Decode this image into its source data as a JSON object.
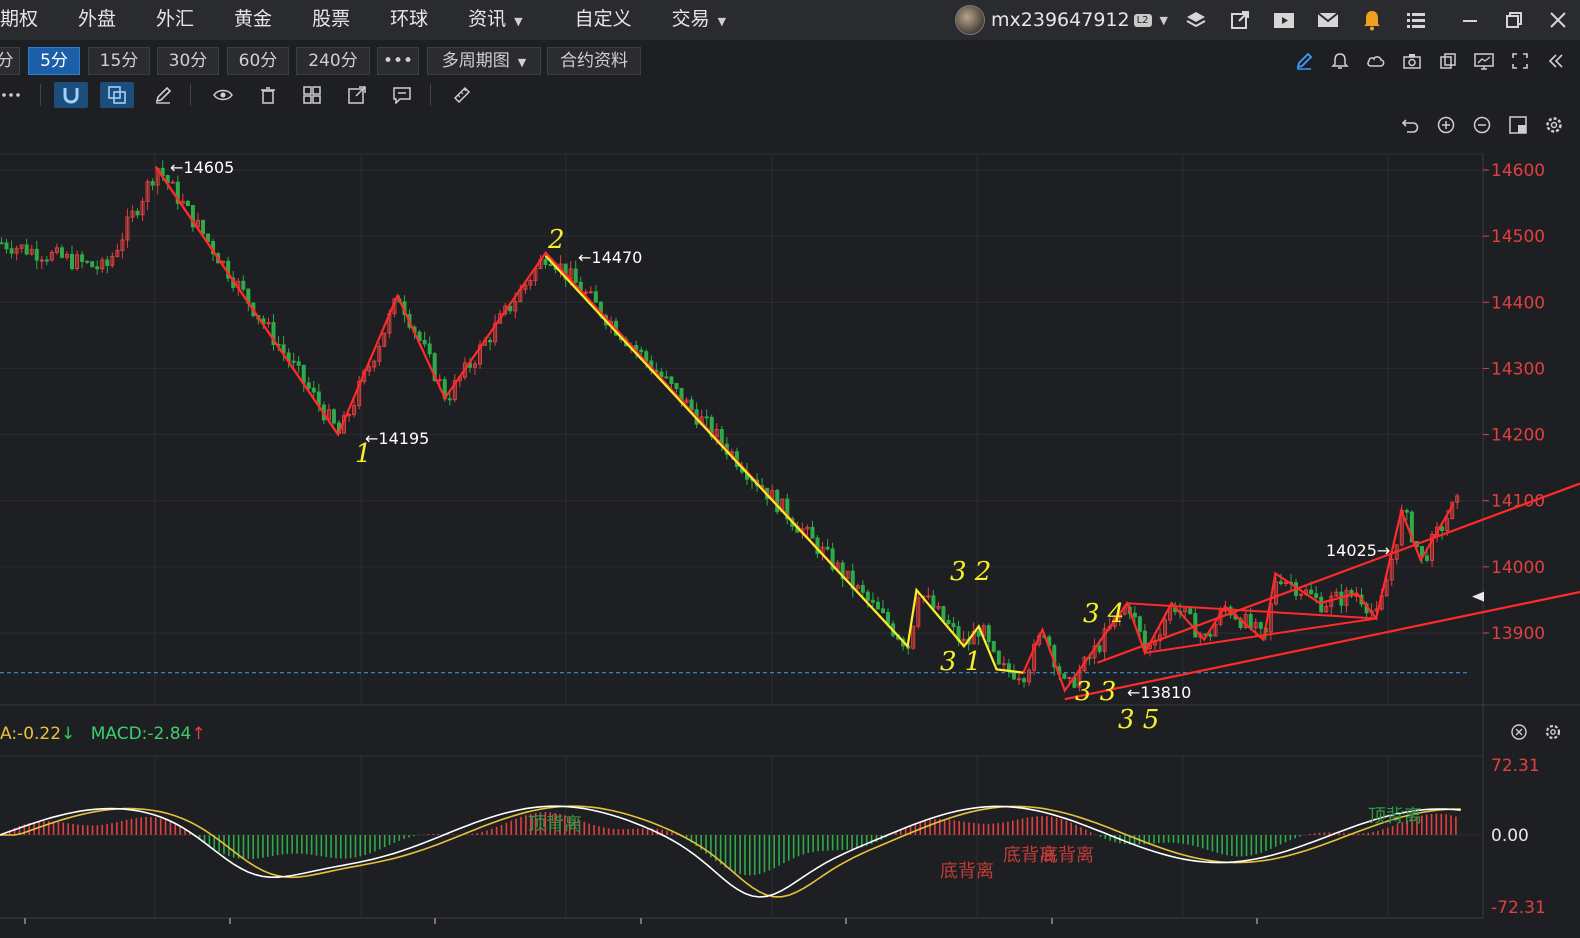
{
  "menu": {
    "items": [
      {
        "label": "期权",
        "caret": false
      },
      {
        "label": "外盘",
        "caret": false
      },
      {
        "label": "外汇",
        "caret": false
      },
      {
        "label": "黄金",
        "caret": false
      },
      {
        "label": "股票",
        "caret": false
      },
      {
        "label": "环球",
        "caret": false
      },
      {
        "label": "资讯",
        "caret": true
      },
      {
        "label": "自定义",
        "caret": false
      },
      {
        "label": "交易",
        "caret": true
      }
    ],
    "username": "mx239647912",
    "badge": "L2",
    "icons": [
      "layers-icon",
      "export-icon",
      "video-icon",
      "mail-icon",
      "bell-icon",
      "list-icon",
      "minimize-icon",
      "restore-icon",
      "close-icon"
    ]
  },
  "periods": {
    "buttons": [
      "分",
      "5分",
      "15分",
      "30分",
      "60分",
      "240分",
      "•••",
      "多周期图",
      "合约资料"
    ],
    "active": "5分",
    "multi_caret": "▼"
  },
  "chart_data": [
    {
      "type": "candlestick",
      "title": "",
      "yaxis_ticks": [
        14600,
        14500,
        14400,
        14300,
        14200,
        14100,
        14000,
        13900
      ],
      "ylim": [
        13830,
        14630
      ],
      "annotations": [
        {
          "text": "←14605",
          "price": 14605,
          "kind": "high"
        },
        {
          "text": "←14470",
          "price": 14470,
          "kind": "high"
        },
        {
          "text": "←14195",
          "price": 14195,
          "kind": "low"
        },
        {
          "text": "←13810",
          "price": 13810,
          "kind": "low"
        },
        {
          "text": "14025→",
          "price": 14025,
          "kind": "high"
        }
      ],
      "current_price_marker": 13955,
      "dashed_line_price": 13840,
      "handwritten_labels": [
        "1",
        "2",
        "3 1",
        "3 2",
        "3 3",
        "3 4",
        "3 5"
      ],
      "wave_points": [
        {
          "bar": 0.105,
          "price": 14605
        },
        {
          "bar": 0.228,
          "price": 14200
        },
        {
          "bar": 0.268,
          "price": 14410
        },
        {
          "bar": 0.3,
          "price": 14255
        },
        {
          "bar": 0.368,
          "price": 14475
        },
        {
          "bar": 0.612,
          "price": 13880
        },
        {
          "bar": 0.618,
          "price": 13965
        },
        {
          "bar": 0.65,
          "price": 13880
        },
        {
          "bar": 0.66,
          "price": 13910
        },
        {
          "bar": 0.672,
          "price": 13845
        },
        {
          "bar": 0.69,
          "price": 13840
        },
        {
          "bar": 0.703,
          "price": 13905
        },
        {
          "bar": 0.718,
          "price": 13813
        },
        {
          "bar": 0.76,
          "price": 13945
        },
        {
          "bar": 0.772,
          "price": 13870
        },
        {
          "bar": 0.79,
          "price": 13945
        },
        {
          "bar": 0.812,
          "price": 13890
        },
        {
          "bar": 0.826,
          "price": 13940
        },
        {
          "bar": 0.852,
          "price": 13890
        },
        {
          "bar": 0.86,
          "price": 13990
        },
        {
          "bar": 0.89,
          "price": 13945
        },
        {
          "bar": 0.915,
          "price": 13960
        },
        {
          "bar": 0.928,
          "price": 13922
        },
        {
          "bar": 0.945,
          "price": 14085
        },
        {
          "bar": 0.958,
          "price": 14010
        },
        {
          "bar": 0.98,
          "price": 14095
        }
      ]
    },
    {
      "type": "macd",
      "legend": [
        {
          "text": "A:-0.22",
          "color": "#e8c23a",
          "arrow": "↓"
        },
        {
          "text": "MACD:-2.84",
          "color": "#3bd06a",
          "arrow": "↑"
        }
      ],
      "yaxis_ticks": [
        "72.31",
        "0.00",
        "-72.31"
      ],
      "ylim": [
        -72.31,
        72.31
      ],
      "labels": [
        {
          "text": "顶背离",
          "color": "#2e9a48"
        },
        {
          "text": "底背离",
          "color": "#c23a3a"
        },
        {
          "text": "底背离",
          "color": "#c23a3a"
        },
        {
          "text": "底背离",
          "color": "#c23a3a"
        },
        {
          "text": "顶背离",
          "color": "#2e9a48"
        }
      ]
    }
  ],
  "colors": {
    "up": "#e04040",
    "down": "#2faa4a",
    "wave_red": "#ff2a2a",
    "wave_yellow": "#f6f02a",
    "axis": "#e04040"
  }
}
